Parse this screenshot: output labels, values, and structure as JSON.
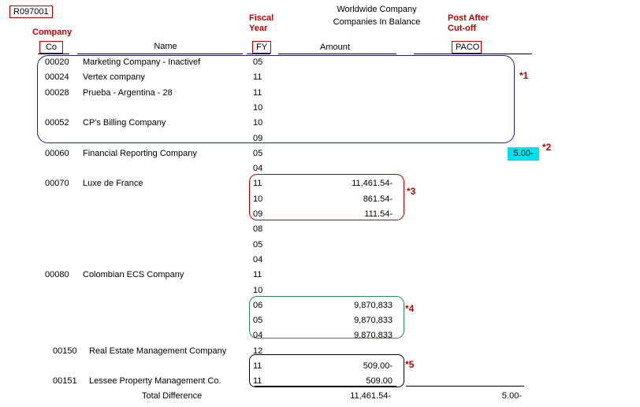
{
  "report_id": "R097001",
  "title_line1": "Worldwide Company",
  "title_line2": "Companies In Balance",
  "annot_headers": {
    "company": "Company",
    "fiscal_year": "Fiscal Year",
    "post_after": "Post After Cut-off"
  },
  "col_headers": {
    "co": "Co",
    "name": "Name",
    "fy": "FY",
    "amount": "Amount",
    "paco": "PACO"
  },
  "rows": [
    {
      "co": "00020",
      "name": "Marketing Company - Inactivef",
      "fy": "05",
      "amount": ""
    },
    {
      "co": "00024",
      "name": "Vertex company",
      "fy": "11",
      "amount": ""
    },
    {
      "co": "00028",
      "name": "Prueba - Argentina - 28",
      "fy": "11",
      "amount": ""
    },
    {
      "co": "",
      "name": "",
      "fy": "10",
      "amount": ""
    },
    {
      "co": "00052",
      "name": "CP's Billing Company",
      "fy": "10",
      "amount": ""
    },
    {
      "co": "",
      "name": "",
      "fy": "09",
      "amount": ""
    },
    {
      "co": "00060",
      "name": "Financial Reporting Company",
      "fy": "05",
      "amount": "",
      "paco": "5.00-"
    },
    {
      "co": "",
      "name": "",
      "fy": "04",
      "amount": ""
    },
    {
      "co": "00070",
      "name": "Luxe de France",
      "fy": "11",
      "amount": "11,461.54-"
    },
    {
      "co": "",
      "name": "",
      "fy": "10",
      "amount": "861.54-"
    },
    {
      "co": "",
      "name": "",
      "fy": "09",
      "amount": "111.54-"
    },
    {
      "co": "",
      "name": "",
      "fy": "08",
      "amount": ""
    },
    {
      "co": "",
      "name": "",
      "fy": "05",
      "amount": ""
    },
    {
      "co": "",
      "name": "",
      "fy": "04",
      "amount": ""
    },
    {
      "co": "00080",
      "name": "Colombian ECS Company",
      "fy": "11",
      "amount": ""
    },
    {
      "co": "",
      "name": "",
      "fy": "10",
      "amount": ""
    },
    {
      "co": "",
      "name": "",
      "fy": "06",
      "amount": "9,870,833"
    },
    {
      "co": "",
      "name": "",
      "fy": "05",
      "amount": "9,870,833"
    },
    {
      "co": "",
      "name": "",
      "fy": "04",
      "amount": "9,870,833"
    },
    {
      "co": "00150",
      "name": "Real Estate Management Company",
      "fy": "12",
      "amount": ""
    },
    {
      "co": "",
      "name": "",
      "fy": "11",
      "amount": "509.00-"
    },
    {
      "co": "00151",
      "name": "Lessee Property Management Co.",
      "fy": "11",
      "amount": "509.00"
    }
  ],
  "totals": {
    "label": "Total Difference",
    "amount": "11,461.54-",
    "paco": "5.00-"
  },
  "notes": [
    "*1",
    "*2",
    "*3",
    "*4",
    "*5"
  ],
  "colors": {
    "annotation_red": "#c00000",
    "box1": "#1f1f8f",
    "box3": "#c00000",
    "box4": "#2e8b57",
    "box5": "#000000",
    "highlight": "#00e0ef"
  }
}
